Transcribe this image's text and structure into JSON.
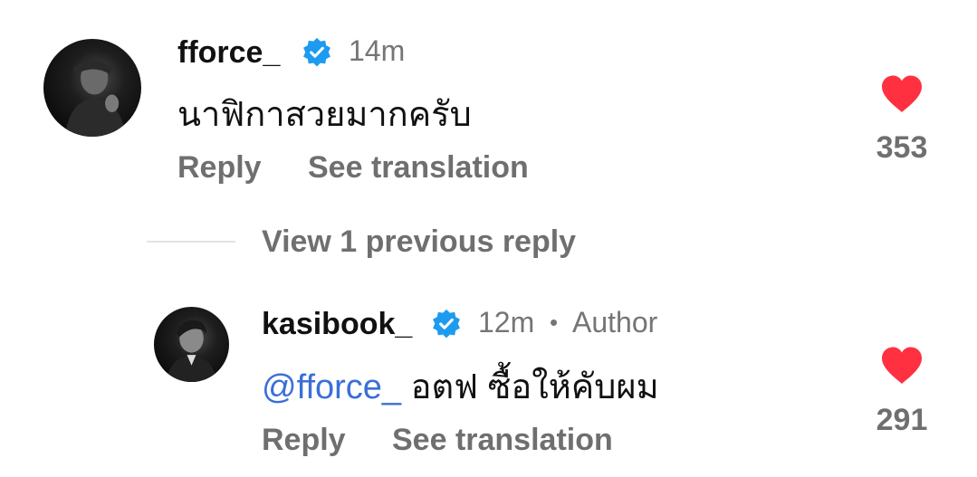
{
  "comment": {
    "username": "fforce_",
    "time": "14m",
    "text": "นาฟิกาสวยมากครับ",
    "reply_label": "Reply",
    "translate_label": "See translation",
    "likes": "353"
  },
  "view_replies_label": "View 1 previous reply",
  "reply": {
    "username": "kasibook_",
    "time": "12m",
    "separator": "•",
    "author_label": "Author",
    "mention": "@fforce_",
    "text": "อตฟ ซื้อให้คับผม",
    "reply_label": "Reply",
    "translate_label": "See translation",
    "likes": "291"
  },
  "colors": {
    "verified": "#1d9bf0",
    "heart": "#ff3040",
    "mention": "#3a6fd8",
    "muted": "#757575"
  },
  "icons": [
    "verified-badge-icon",
    "heart-icon"
  ]
}
